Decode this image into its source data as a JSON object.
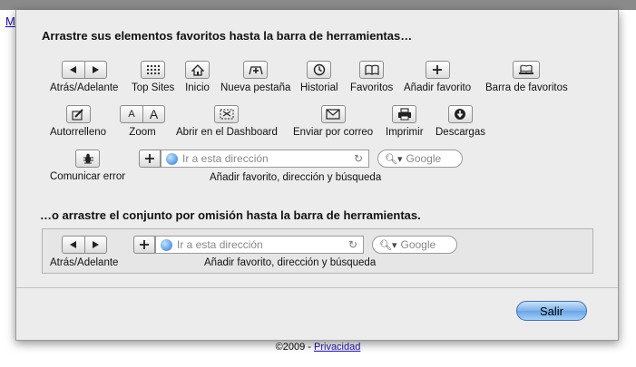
{
  "background": {
    "top_link": "M",
    "footer_copyright": "©2009 - ",
    "footer_link": "Privacidad"
  },
  "sheet": {
    "heading_drag_items": "Arrastre sus elementos favoritos hasta la barra de herramientas…",
    "heading_drag_default": "…o arrastre el conjunto por omisión hasta la barra de herramientas.",
    "items": {
      "back_forward": "Atrás/Adelante",
      "top_sites": "Top Sites",
      "home": "Inicio",
      "new_tab": "Nueva pestaña",
      "history": "Historial",
      "bookmarks": "Favoritos",
      "add_bookmark": "Añadir favorito",
      "bookmarks_bar": "Barra de favoritos",
      "autofill": "Autorrelleno",
      "zoom": "Zoom",
      "zoom_small": "A",
      "zoom_large": "A",
      "open_dashboard": "Abrir en el Dashboard",
      "mail": "Enviar por correo",
      "print": "Imprimir",
      "downloads": "Descargas",
      "report_bug": "Comunicar error",
      "address_combo": "Añadir favorito, dirección y búsqueda"
    },
    "address_placeholder": "Ir a esta dirección",
    "search_placeholder": "Google",
    "default_set": {
      "back_forward": "Atrás/Adelante",
      "address_combo": "Añadir favorito, dirección y búsqueda",
      "address_placeholder": "Ir a esta dirección",
      "search_placeholder": "Google"
    },
    "done_button": "Salir"
  },
  "colors": {
    "sheet_bg": "#ececec",
    "done_button": "#7fb3ea",
    "link": "#1a0dab"
  }
}
